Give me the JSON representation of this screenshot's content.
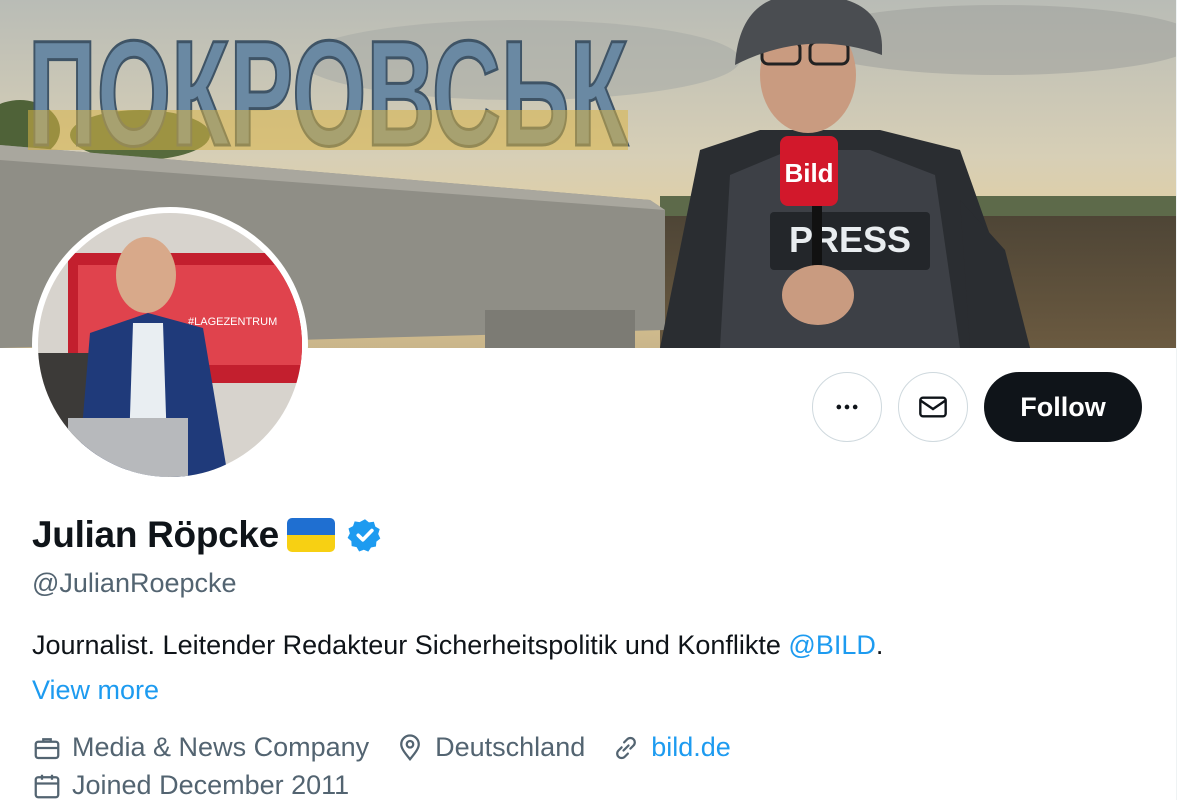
{
  "profile": {
    "name": "Julian Röpcke",
    "handle": "@JulianRoepcke",
    "bio_text": "Journalist. Leitender Redakteur Sicherheitspolitik und Konflikte ",
    "bio_mention": "@BILD",
    "bio_end": ".",
    "view_more": "View more",
    "category": "Media & News Company",
    "location": "Deutschland",
    "website": "bild.de",
    "joined": "Joined December 2011"
  },
  "banner": {
    "sign_text": "ПОКРОВСЬК",
    "mic_label": "Bild",
    "vest_label": "PRESS"
  },
  "avatar": {
    "screen_text": "#LAGEZENTRUM"
  },
  "actions": {
    "more_icon": "more-horizontal-icon",
    "message_icon": "envelope-icon",
    "follow_label": "Follow"
  },
  "colors": {
    "accent": "#1d9bf0",
    "text_primary": "#0f1419",
    "text_secondary": "#536471",
    "follow_bg": "#0f1419",
    "flag_blue": "#1f6fd1",
    "flag_yellow": "#f7d013"
  }
}
